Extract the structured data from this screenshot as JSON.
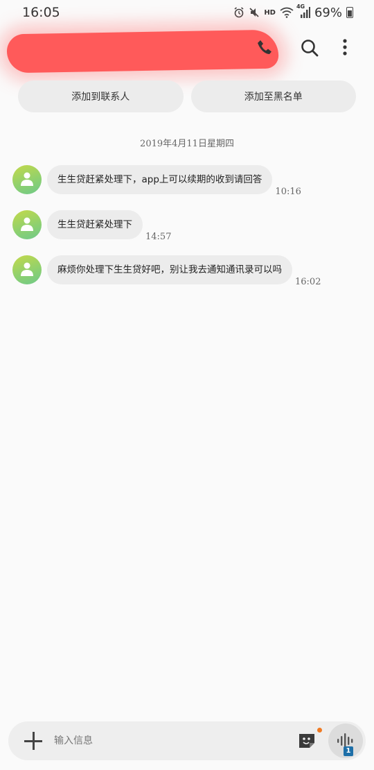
{
  "status_bar": {
    "time": "16:05",
    "hd": "HD",
    "network": "4G",
    "battery": "69%"
  },
  "header": {
    "back_icon": "back-arrow-icon",
    "call_icon": "phone-icon",
    "search_icon": "search-icon",
    "more_icon": "more-vert-icon",
    "redaction_color": "#ff5a5a"
  },
  "actions": {
    "add_contact": "添加到联系人",
    "add_blacklist": "添加至黑名单"
  },
  "date_separator": "2019年4月11日星期四",
  "messages": [
    {
      "text": "生生贷赶紧处理下，app上可以续期的收到请回答",
      "time": "10:16"
    },
    {
      "text": "生生贷赶紧处理下",
      "time": "14:57"
    },
    {
      "text": "麻烦你处理下生生贷好吧，别让我去通知通讯录可以吗",
      "time": "16:02"
    }
  ],
  "composer": {
    "placeholder": "输入信息",
    "sim_slot": "1",
    "accent": "#1e6fa8",
    "notification_dot": "#f07a22"
  }
}
